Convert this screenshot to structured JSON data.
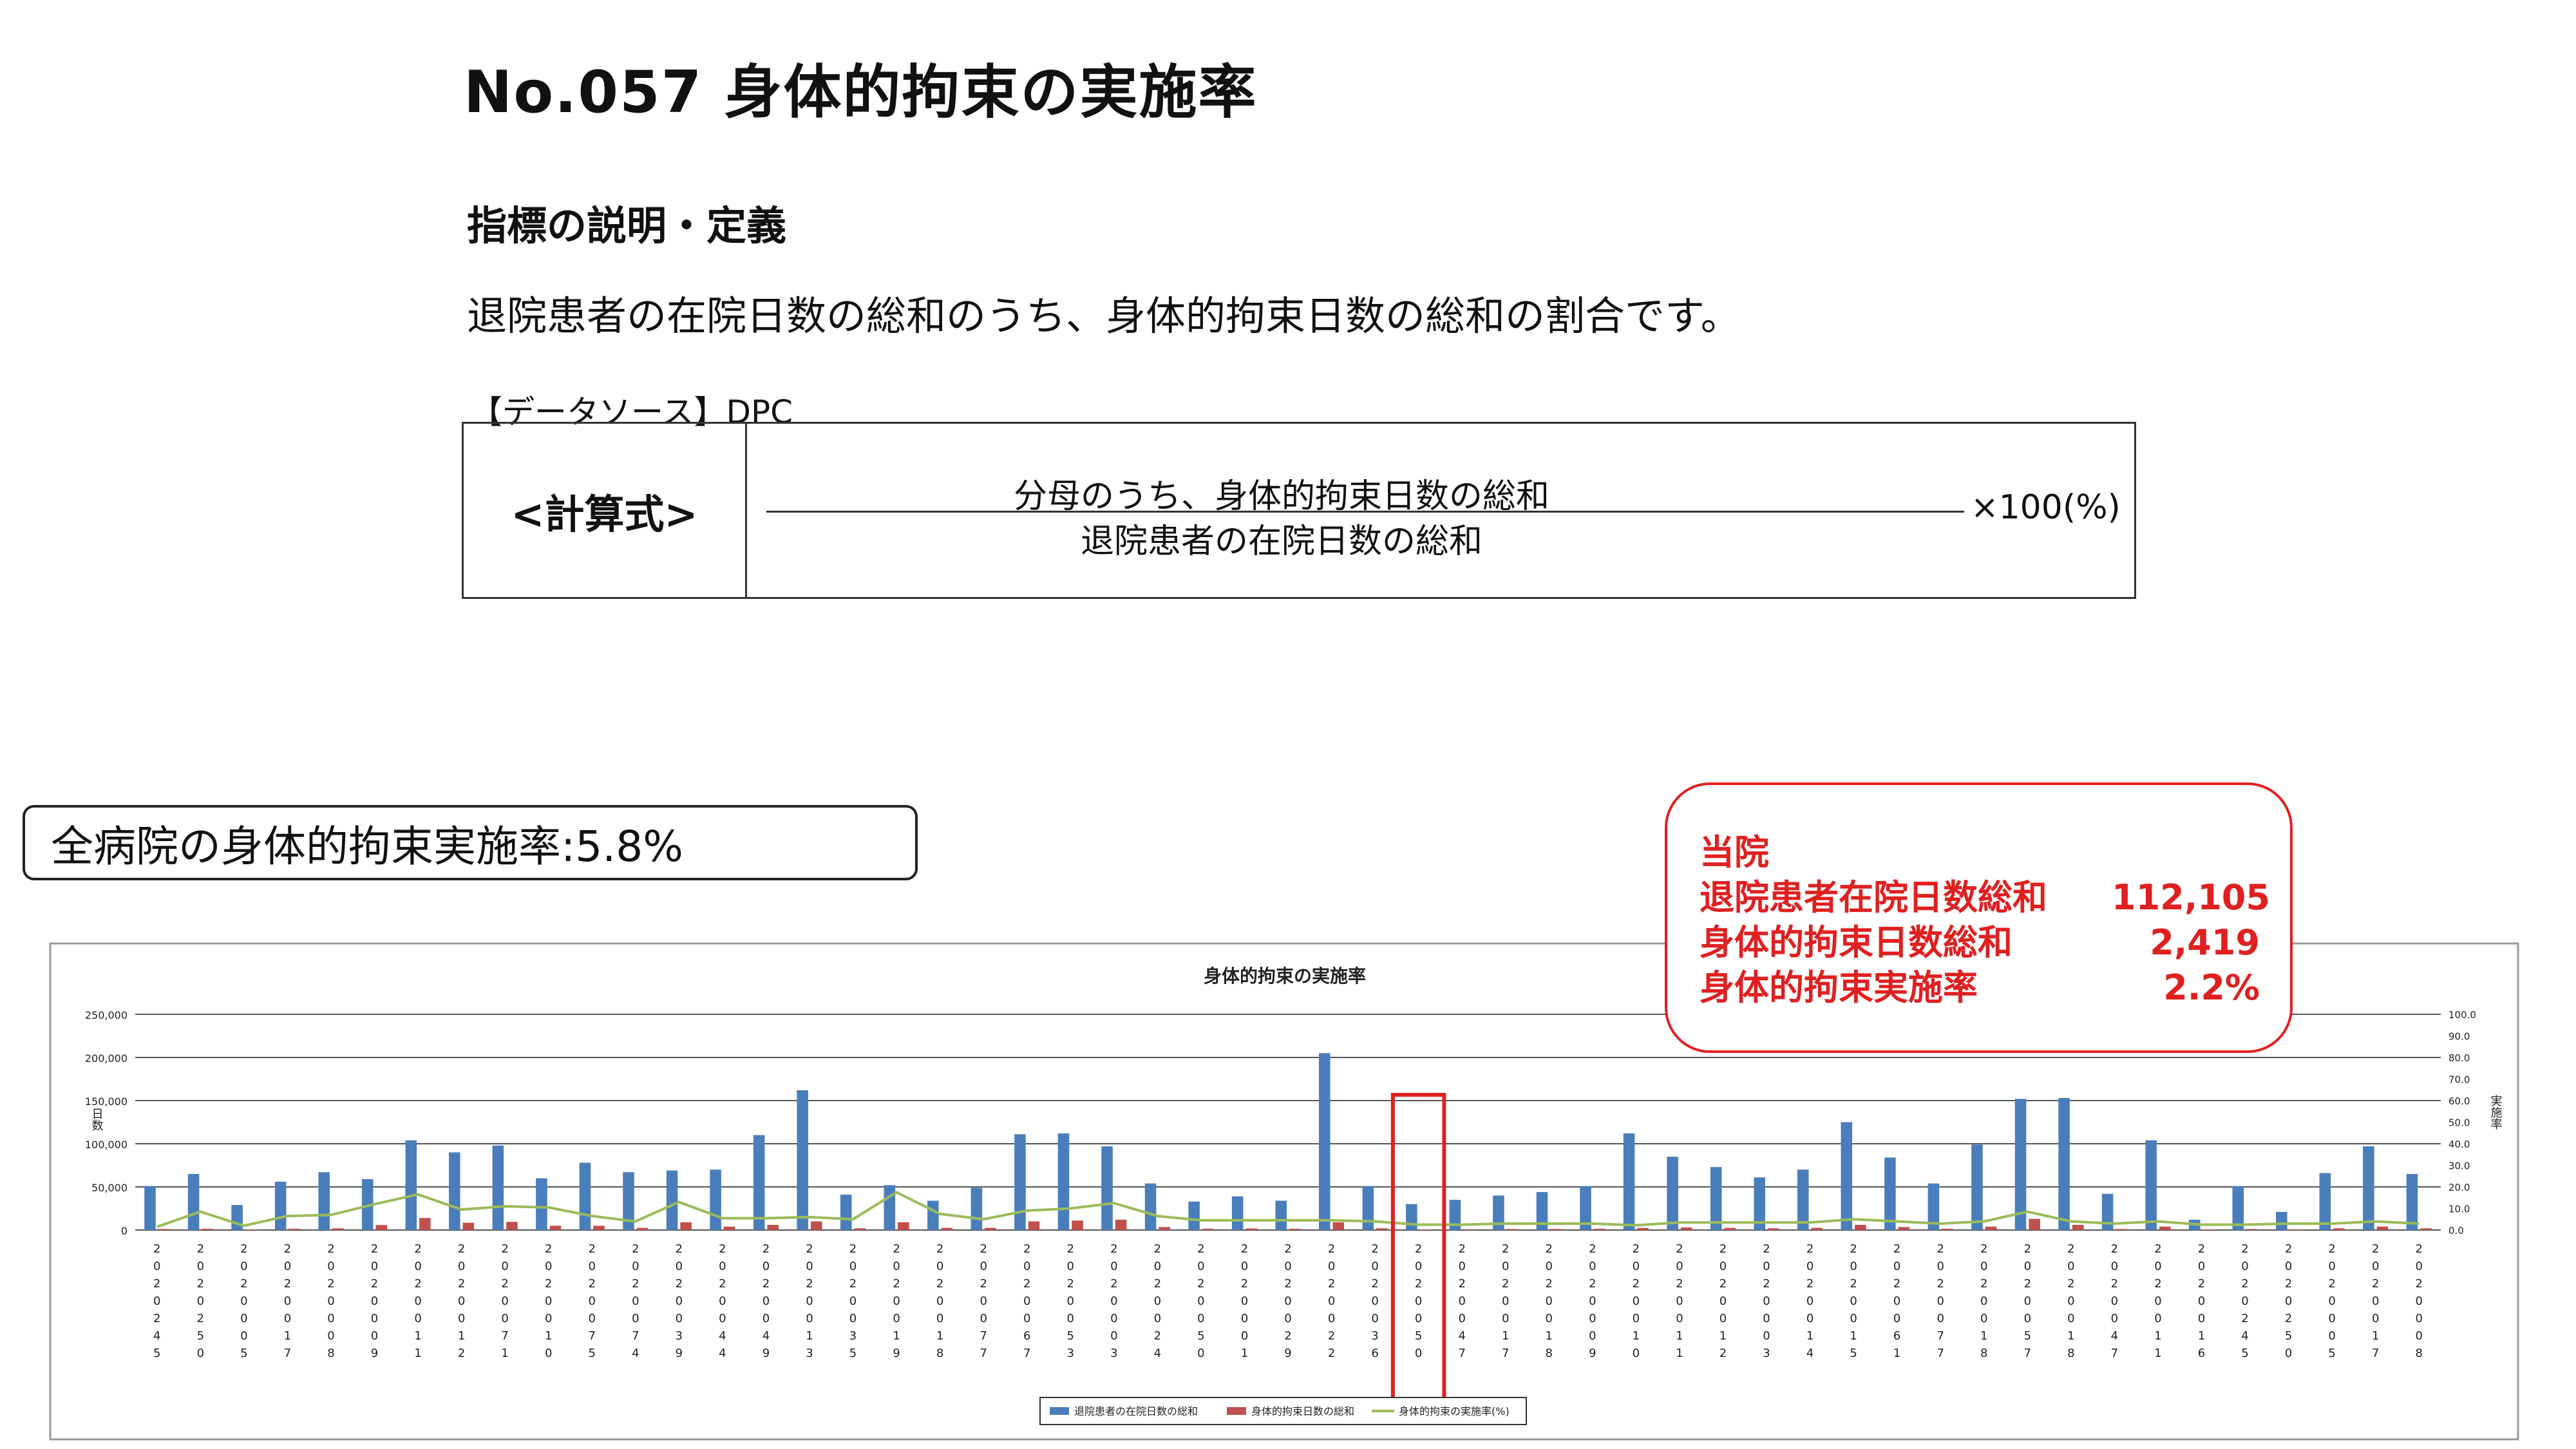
{
  "header": {
    "title": "No.057 身体的拘束の実施率",
    "section_heading": "指標の説明・定義",
    "definition": "退院患者の在院日数の総和のうち、身体的拘束日数の総和の割合です。",
    "data_source": "【データソース】DPC"
  },
  "formula": {
    "label": "<計算式>",
    "numerator": "分母のうち、身体的拘束日数の総和",
    "denominator": "退院患者の在院日数の総和",
    "multiplier": "×100(%)"
  },
  "overall_rate": "全病院の身体的拘束実施率:5.8%",
  "callout": {
    "heading": "当院",
    "rows": [
      {
        "label": "退院患者在院日数総和",
        "value": "112,105"
      },
      {
        "label": "身体的拘束日数総和",
        "value": "2,419"
      },
      {
        "label": "身体的拘束実施率",
        "value": "2.2%"
      }
    ]
  },
  "colors": {
    "bar_total_days": "#4a7ebb",
    "bar_restraint_days": "#c0504d",
    "line_rate": "#9bbb59",
    "highlight": "#e02020"
  },
  "chart_data": {
    "type": "bar",
    "title": "身体的拘束の実施率",
    "y_left_ticks": [
      "250,000",
      "200,000",
      "150,000",
      "100,000",
      "50,000",
      "0"
    ],
    "y_right_ticks": [
      "100.0",
      "90.0",
      "80.0",
      "70.0",
      "60.0",
      "50.0",
      "40.0",
      "30.0",
      "20.0",
      "10.0",
      "0.0"
    ],
    "ylim_left": [
      0,
      250000
    ],
    "ylim_right": [
      0,
      100
    ],
    "ylabel_left": "日数",
    "ylabel_right": "実施率",
    "categories": [
      "0245",
      "0250",
      "0005",
      "0017",
      "0008",
      "0009",
      "0011",
      "0012",
      "0071",
      "0010",
      "0075",
      "0074",
      "0039",
      "0044",
      "0049",
      "0013",
      "0035",
      "0019",
      "0018",
      "0077",
      "0067",
      "0053",
      "0003",
      "0024",
      "0050",
      "0001",
      "0029",
      "0022",
      "0036",
      "0050",
      "0047",
      "0017",
      "0018",
      "0009",
      "0010",
      "0011",
      "0012",
      "0003",
      "0014",
      "0015",
      "0061",
      "0077",
      "0018",
      "0057",
      "0018",
      "0047",
      "0011",
      "0016"
    ],
    "highlight_index": 29,
    "series": [
      {
        "name": "退院患者の在院日数の総和",
        "values": [
          51000,
          65000,
          29000,
          56000,
          67000,
          59000,
          104000,
          90000,
          98000,
          60000,
          78000,
          67000,
          69000,
          70000,
          110000,
          162000,
          41000,
          52000,
          34000,
          49000,
          111000,
          112000,
          97000,
          54000,
          33000,
          39000,
          34000,
          205000,
          51000,
          30000,
          35000,
          40000,
          44000,
          51000,
          112000,
          85000,
          73000,
          61000,
          70000,
          125000,
          84000,
          54000,
          99000,
          152000,
          153000,
          42000,
          104000,
          12000,
          51000,
          21000,
          66000,
          97000,
          65000
        ]
      },
      {
        "name": "身体的拘束日数の総和",
        "values": [
          1200,
          1500,
          600,
          1500,
          2000,
          5800,
          14000,
          8500,
          9500,
          5000,
          5000,
          2500,
          9000,
          4000,
          6000,
          10000,
          2000,
          9000,
          2500,
          2500,
          10000,
          11000,
          12000,
          3500,
          1500,
          1800,
          1500,
          9000,
          2000,
          700,
          900,
          1200,
          1300,
          1500,
          2419,
          3000,
          2500,
          2000,
          2500,
          6000,
          3500,
          1500,
          4000,
          13000,
          6000,
          1200,
          4000,
          300,
          1200,
          600,
          2000,
          4000,
          2000
        ]
      },
      {
        "name": "身体的拘束の実施率(%)",
        "values": [
          1.5,
          8.5,
          2.0,
          6.5,
          7.0,
          12.0,
          16.5,
          9.5,
          11.0,
          10.5,
          6.5,
          4.0,
          13.0,
          5.5,
          5.5,
          6.0,
          5.0,
          17.5,
          7.5,
          5.0,
          9.0,
          10.0,
          12.5,
          6.5,
          4.5,
          4.5,
          4.5,
          4.5,
          4.0,
          2.5,
          2.5,
          3.0,
          3.0,
          3.0,
          2.2,
          3.5,
          3.5,
          3.5,
          3.5,
          5.0,
          4.0,
          3.0,
          4.0,
          8.5,
          4.0,
          3.0,
          4.0,
          2.5,
          2.5,
          3.0,
          3.0,
          4.0,
          3.0
        ]
      }
    ],
    "legend_position": "bottom"
  }
}
